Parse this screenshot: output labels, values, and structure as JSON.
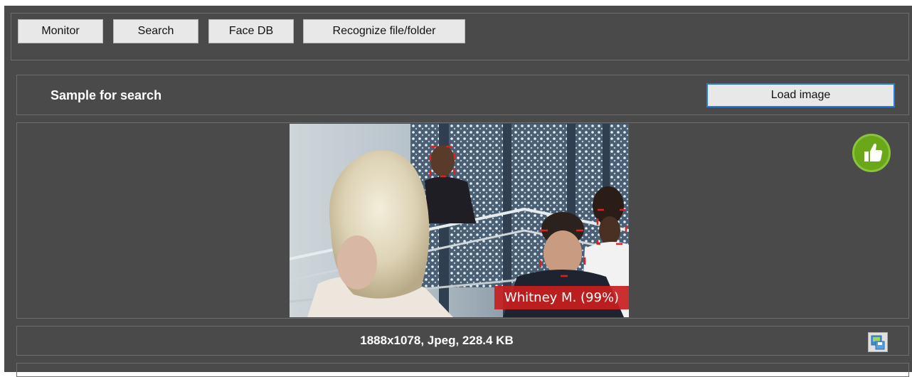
{
  "toolbar": {
    "tabs": [
      {
        "label": "Monitor"
      },
      {
        "label": "Search"
      },
      {
        "label": "Face DB"
      },
      {
        "label": "Recognize file/folder"
      }
    ]
  },
  "sample": {
    "title": "Sample for search",
    "load_button": "Load image"
  },
  "photo": {
    "match_label": "Whitney M. (99%)",
    "status_icon": "thumbs-up-icon"
  },
  "image_info": {
    "text": "1888x1078, Jpeg, 228.4 KB",
    "save_icon": "save-image-icon"
  },
  "colors": {
    "background": "#4a4a4a",
    "face_box": "#e0201e",
    "label_bg": "#c81e1e",
    "status_ok": "#6aa81a",
    "focus_border": "#2b7bd4"
  }
}
